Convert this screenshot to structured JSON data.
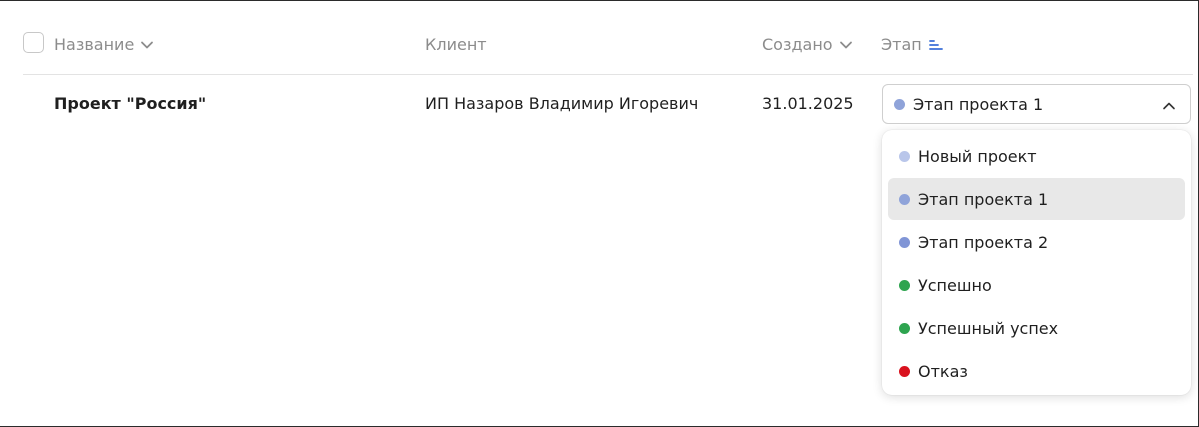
{
  "table": {
    "headers": {
      "name": "Название",
      "client": "Клиент",
      "created": "Создано",
      "stage": "Этап"
    },
    "rows": [
      {
        "name": "Проект \"Россия\"",
        "client": "ИП Назаров Владимир Игоревич",
        "created": "31.01.2025",
        "stage": "Этап проекта 1"
      }
    ]
  },
  "stage_select": {
    "value": "Этап проекта 1",
    "value_color": "#8fa3d9",
    "options": [
      {
        "label": "Новый проект",
        "color": "#b9c6ea"
      },
      {
        "label": "Этап проекта 1",
        "color": "#8fa3d9",
        "selected": true
      },
      {
        "label": "Этап проекта 2",
        "color": "#8095d6"
      },
      {
        "label": "Успешно",
        "color": "#2ea44f"
      },
      {
        "label": "Успешный успех",
        "color": "#2ea44f"
      },
      {
        "label": "Отказ",
        "color": "#d9121e"
      }
    ]
  },
  "colors": {
    "accent": "#3b6fd8",
    "selected_bg": "#e8e8e8"
  },
  "icons": {
    "name_sort": "chevron-down-icon",
    "created_sort": "chevron-down-icon",
    "stage_sort": "sort-lines-icon",
    "select_toggle": "chevron-up-icon"
  }
}
